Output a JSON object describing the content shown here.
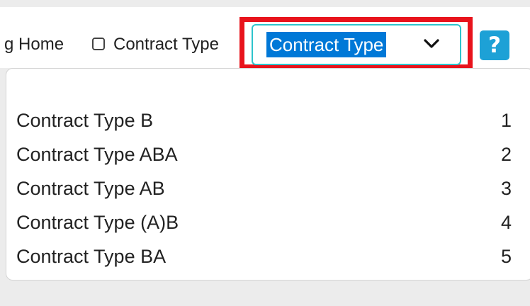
{
  "toolbar": {
    "home_label": "g Home",
    "contract_type_checkbox_label": "Contract Type",
    "contract_type_checked": false,
    "select_value": "Contract Type",
    "help_label": "?"
  },
  "dropdown": {
    "options": [
      {
        "label": "Contract Type B",
        "number": "1"
      },
      {
        "label": "Contract Type ABA",
        "number": "2"
      },
      {
        "label": "Contract Type AB",
        "number": "3"
      },
      {
        "label": "Contract Type (A)B",
        "number": "4"
      },
      {
        "label": "Contract Type BA",
        "number": "5"
      }
    ]
  },
  "colors": {
    "focus_outline": "#e8131c",
    "select_border": "#2ec4cc",
    "selection_highlight": "#0078d7",
    "help_button": "#1da1d6"
  },
  "icons": {
    "select_arrow": "chevron-down-icon",
    "help": "help-icon"
  }
}
